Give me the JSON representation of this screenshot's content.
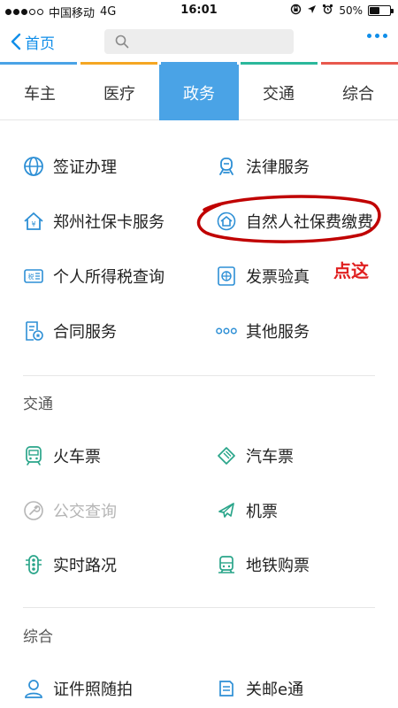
{
  "status": {
    "carrier": "中国移动",
    "network": "4G",
    "time": "16:01",
    "battery_percent": "50%",
    "battery_level": 0.5,
    "signal_bars": 3
  },
  "nav": {
    "back_label": "首页",
    "search_placeholder": ""
  },
  "colors": {
    "accent": "#108ee9",
    "active_tab": "#4aa3e6",
    "strip": [
      "#4aa3e6",
      "#f5a623",
      "#4aa3e6",
      "#2bb89b",
      "#e8584d"
    ],
    "annotation": "#c00000",
    "icon_blue": "#2d8fd5",
    "icon_green": "#2aa58a"
  },
  "tabs": [
    {
      "label": "车主",
      "active": false
    },
    {
      "label": "医疗",
      "active": false
    },
    {
      "label": "政务",
      "active": true
    },
    {
      "label": "交通",
      "active": false
    },
    {
      "label": "综合",
      "active": false
    }
  ],
  "gov_services": [
    {
      "label": "签证办理",
      "icon": "globe-icon"
    },
    {
      "label": "法律服务",
      "icon": "law-icon"
    },
    {
      "label": "郑州社保卡服务",
      "icon": "social-security-card-icon"
    },
    {
      "label": "自然人社保费缴费",
      "icon": "social-insurance-payment-icon"
    },
    {
      "label": "个人所得税查询",
      "icon": "tax-icon"
    },
    {
      "label": "发票验真",
      "icon": "invoice-icon"
    },
    {
      "label": "合同服务",
      "icon": "contract-icon"
    },
    {
      "label": "其他服务",
      "icon": "more-dots-icon"
    }
  ],
  "transport": {
    "title": "交通",
    "items": [
      {
        "label": "火车票",
        "icon": "train-icon",
        "disabled": false
      },
      {
        "label": "汽车票",
        "icon": "bus-ticket-icon",
        "disabled": false
      },
      {
        "label": "公交查询",
        "icon": "wrench-icon",
        "disabled": true
      },
      {
        "label": "机票",
        "icon": "plane-icon",
        "disabled": false
      },
      {
        "label": "实时路况",
        "icon": "traffic-light-icon",
        "disabled": false
      },
      {
        "label": "地铁购票",
        "icon": "subway-icon",
        "disabled": false
      }
    ]
  },
  "general": {
    "title": "综合",
    "items": [
      {
        "label": "证件照随拍",
        "icon": "person-icon"
      },
      {
        "label": "关邮e通",
        "icon": "customs-mail-icon"
      }
    ]
  },
  "annotation": {
    "text": "点这"
  }
}
